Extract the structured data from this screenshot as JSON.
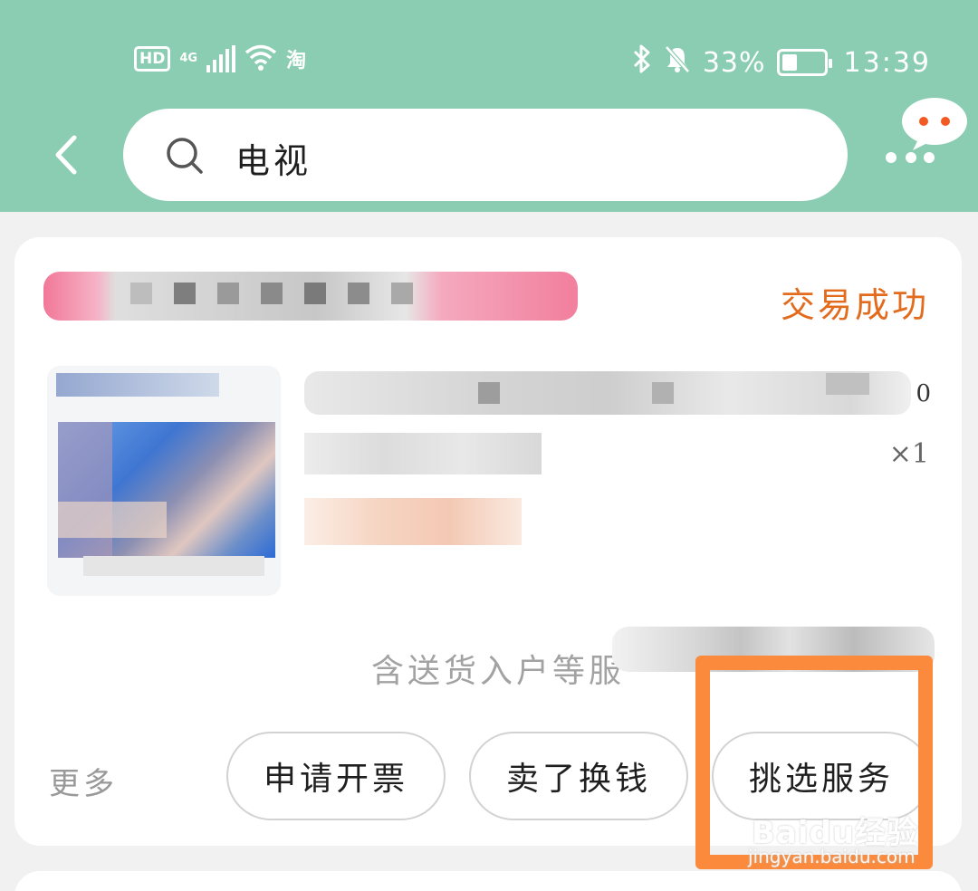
{
  "status_bar": {
    "hd": "HD",
    "network": "4G",
    "battery": "33%",
    "time": "13:39"
  },
  "search": {
    "query": "电视"
  },
  "order": {
    "status": "交易成功",
    "quantity": "×1",
    "price_tail": "0",
    "service_note": "含送货入户等服"
  },
  "actions": {
    "more": "更多",
    "invoice": "申请开票",
    "sell": "卖了换钱",
    "service": "挑选服务"
  },
  "watermark": {
    "brand": "Baidu经验",
    "url": "jingyan.baidu.com"
  },
  "colors": {
    "header": "#8acdb2",
    "status_text": "#e36b1e",
    "highlight": "#fb8a3c"
  }
}
